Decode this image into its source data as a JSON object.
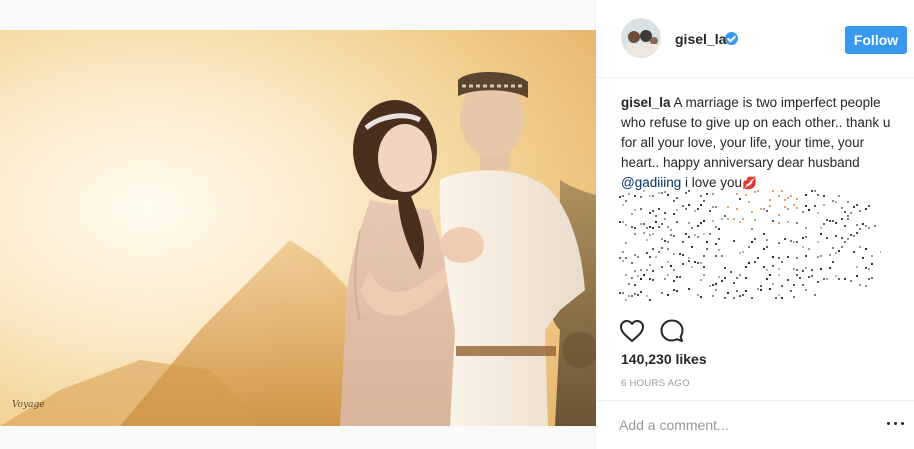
{
  "post": {
    "image_alt": "Wedding couple at sunset",
    "watermark": "Voyage"
  },
  "header": {
    "username": "gisel_la",
    "follow_label": "Follow"
  },
  "caption": {
    "username": "gisel_la",
    "text": " A marriage is two imperfect people who refuse to give up on each other.. thank u for all your love, your life, your time, your heart.. happy anniversary dear husband ",
    "mention": "@gadiiing",
    "text_end": " i love you",
    "emoji": "💋"
  },
  "icons": {
    "like": "heart-icon",
    "comment": "comment-icon",
    "verified": "verified-badge-icon",
    "more": "more-options-icon"
  },
  "colors": {
    "accent": "#3897f0",
    "mention": "#003569",
    "muted": "#999999",
    "text": "#262626"
  },
  "stats": {
    "likes": "140,230 likes",
    "time_ago": "6 HOURS AGO"
  },
  "comment_box": {
    "placeholder": "Add a comment..."
  }
}
